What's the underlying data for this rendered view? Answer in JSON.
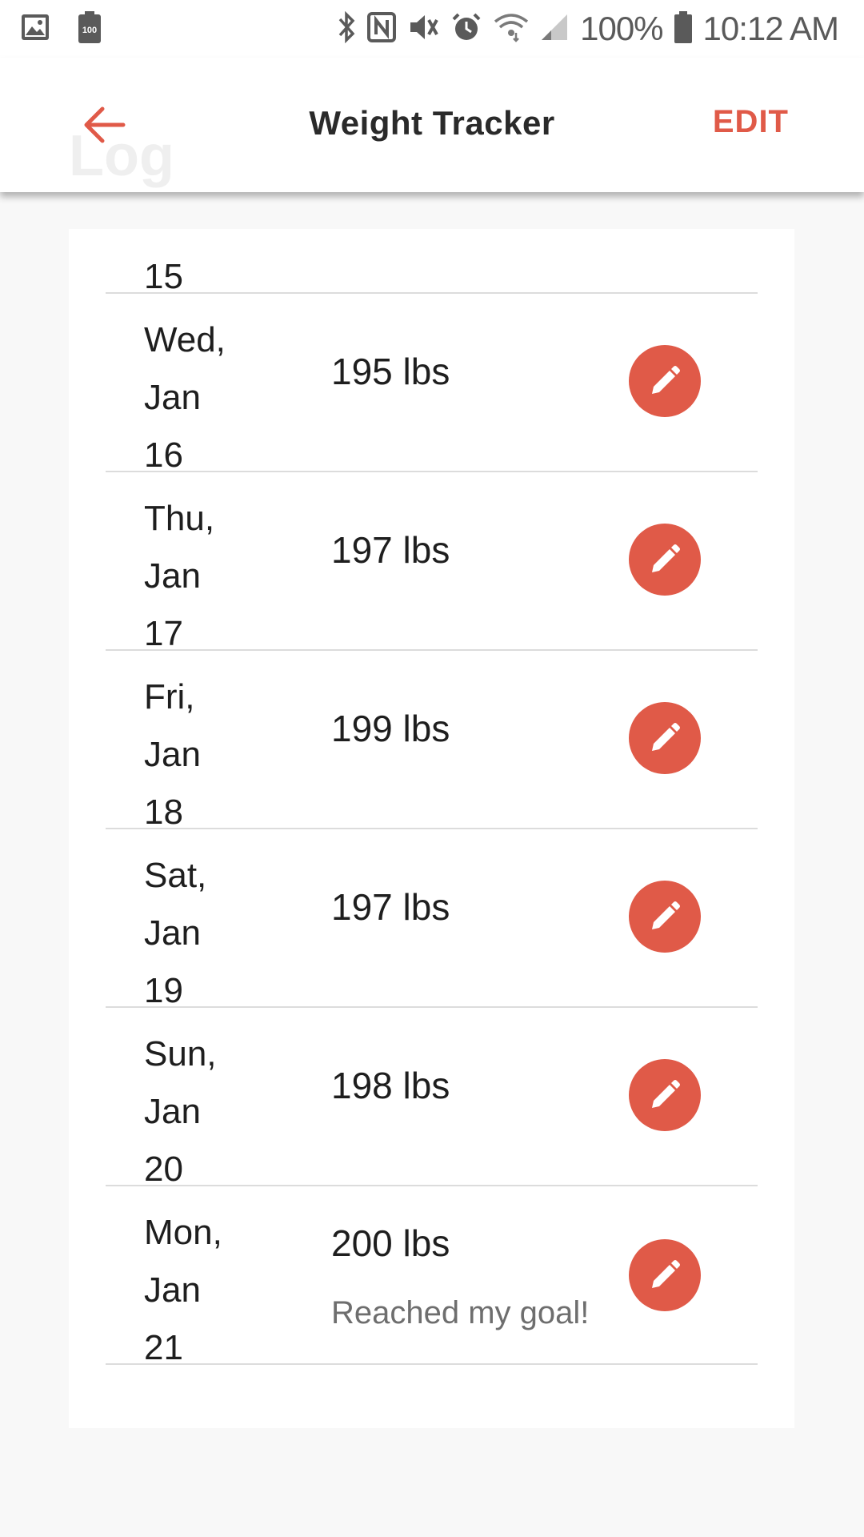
{
  "status_bar": {
    "battery_percent": "100%",
    "time": "10:12 AM",
    "icons": [
      "image-icon",
      "battery-saver-icon",
      "bluetooth-icon",
      "nfc-icon",
      "vibrate-mute-icon",
      "alarm-icon",
      "wifi-icon",
      "signal-icon",
      "battery-icon"
    ]
  },
  "app_bar": {
    "title": "Weight Tracker",
    "edit_label": "EDIT",
    "ghost_title": "Log",
    "accent": "#e05a48"
  },
  "partial_entry": {
    "date_line3": "15"
  },
  "entries": [
    {
      "day": "Wed,",
      "month": "Jan",
      "date": "16",
      "weight": "195 lbs",
      "note": ""
    },
    {
      "day": "Thu,",
      "month": "Jan",
      "date": "17",
      "weight": "197 lbs",
      "note": ""
    },
    {
      "day": "Fri,",
      "month": "Jan",
      "date": "18",
      "weight": "199 lbs",
      "note": ""
    },
    {
      "day": "Sat,",
      "month": "Jan",
      "date": "19",
      "weight": "197 lbs",
      "note": ""
    },
    {
      "day": "Sun,",
      "month": "Jan",
      "date": "20",
      "weight": "198 lbs",
      "note": ""
    },
    {
      "day": "Mon,",
      "month": "Jan",
      "date": "21",
      "weight": "200 lbs",
      "note": "Reached my goal!"
    }
  ]
}
